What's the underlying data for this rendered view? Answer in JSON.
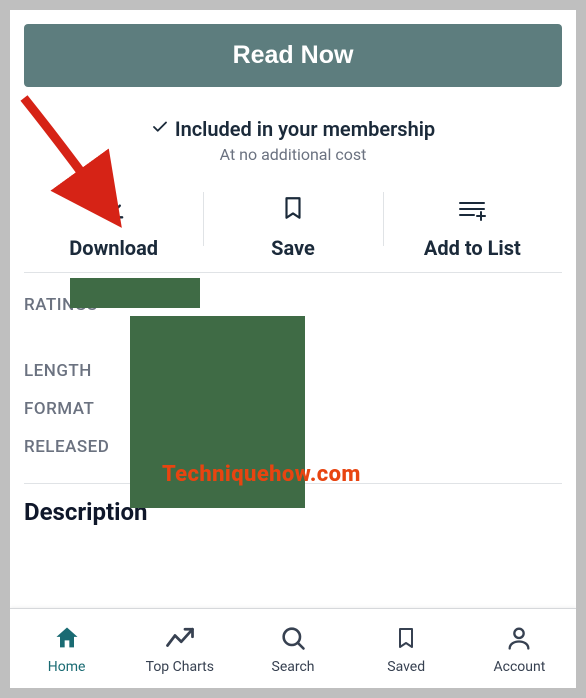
{
  "header": {
    "read_now_label": "Read Now"
  },
  "membership": {
    "text": "Included in your membership",
    "sub": "At no additional cost"
  },
  "actions": {
    "download": "Download",
    "save": "Save",
    "add_to_list": "Add to List"
  },
  "meta": {
    "ratings_label": "RATINGS",
    "length_label": "LENGTH",
    "format_label": "FORMAT",
    "released_label": "RELEASED"
  },
  "description": {
    "heading": "Description"
  },
  "nav": {
    "home": "Home",
    "top_charts": "Top Charts",
    "search": "Search",
    "saved": "Saved",
    "account": "Account"
  },
  "watermark": "Techniquehow.com"
}
